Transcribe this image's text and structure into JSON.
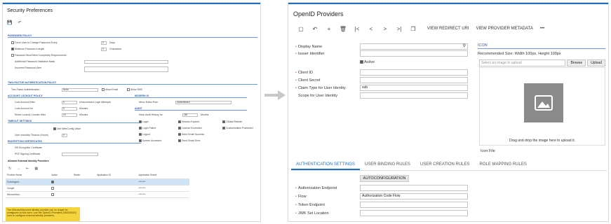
{
  "left": {
    "title": "Security Preferences",
    "sections": {
      "password_policy": "PASSWORD POLICY",
      "tfa_policy": "TWO-FACTOR AUTHENTICATION POLICY",
      "lockout": "ACCOUNT LOCKOUT POLICY",
      "modern_ui": "MODERN UI",
      "timeout": "TIMEOUT SETTINGS",
      "audit": "AUDIT",
      "encryption": "ENCRYPTION CERTIFICATES",
      "external_providers": "Allowed External Identity Providers"
    },
    "password": {
      "force_change": "Force User to Change Password Every",
      "force_change_val": "0",
      "days": "Days",
      "min_length": "Minimum Password Length",
      "min_length_val": "3",
      "characters": "Characters",
      "complexity": "Password Must Meet Complexity Requirements",
      "validation_mask": "Additional Password Validation Mask",
      "incorrect_alert": "Incorrect Password Alert"
    },
    "tfa": {
      "label": "Two-Factor Authentication",
      "value": "None",
      "allow_email": "Allow Email",
      "allow_sms": "Allow SMS"
    },
    "lockout": {
      "lock_after": "Lock Account After",
      "lock_after_val": "5",
      "unsuccessful": "Unsuccessful Login Attempts",
      "lock_for": "Lock Account for",
      "lock_for_val": "5",
      "minutes": "Minutes",
      "reset": "Reset Lockout Counter After",
      "reset_val": "10",
      "minutes2": "Minutes"
    },
    "modern": {
      "menu_editor": "Menu Editor Role",
      "menu_editor_val": "Administrator"
    },
    "audit": {
      "keep_history": "Keep Audit History for",
      "keep_history_val": "180",
      "months": "Months",
      "items": [
        "Login",
        "Session Expired",
        "OData Refresh",
        "Login Failed",
        "License Exceeded",
        "Customization Published",
        "Logout",
        "Send Email Success",
        "Screen Accessed",
        "Send Email Error"
      ]
    },
    "timeout": {
      "use_webconfig": "Use WebConfig Value",
      "inactivity": "User Inactivity Timeout (Hours)",
      "inactivity_val": "0"
    },
    "encryption": {
      "db": "DB Encryption Certificate",
      "pdf": "PDF Signing Certificate"
    },
    "grid": {
      "headers": [
        "Provider Name",
        "Active",
        "Realm",
        "Application ID",
        "Application Secret"
      ],
      "rows": [
        {
          "name": "ExchangeId...",
          "secret": "********"
        },
        {
          "name": "Google",
          "secret": "********"
        },
        {
          "name": "MicrosoftAcc...",
          "secret": "********"
        }
      ]
    },
    "warning": "The MicrosoftAccount identity provider can no longer be configured on this form. Use the OpenID Providers (SM303020) form to configure external identity providers."
  },
  "right": {
    "title": "OpenID Providers",
    "toolbar": {
      "view_redirect": "VIEW REDIRECT URI",
      "view_metadata": "VIEW PROVIDER METADATA",
      "more": "•••"
    },
    "fields": {
      "display_name": "Display Name",
      "issuer": "Issuer Identifier",
      "active": "Active",
      "client_id": "Client ID",
      "client_secret": "Client Secret",
      "claim_type": "Claim Type for User Identity",
      "claim_type_val": "sub",
      "scope": "Scope for User Identity"
    },
    "icon": {
      "header": "ICON",
      "recommended": "Recommended Size: Width 100px, Height 100px",
      "select_placeholder": "Select an image to upload",
      "browse": "Browse",
      "upload": "Upload",
      "drag": "Drag and drop the image here to upload it.",
      "file": "Icon File"
    },
    "tabs": [
      "AUTHENTICATION SETTINGS",
      "USER BINDING RULES",
      "USER CREATION RULES",
      "ROLE MAPPING RULES"
    ],
    "auth": {
      "autoconf": "AUTOCONFIGURATION",
      "endpoint": "Authorization Endpoint",
      "flow": "Flow",
      "flow_val": "Authorization Code Flow",
      "token": "Token Endpoint",
      "jwk": "JWK Set Location"
    }
  },
  "colors": {
    "accent": "#1e6fc2",
    "warning": "#f5d33c",
    "required": "#d9534f"
  }
}
